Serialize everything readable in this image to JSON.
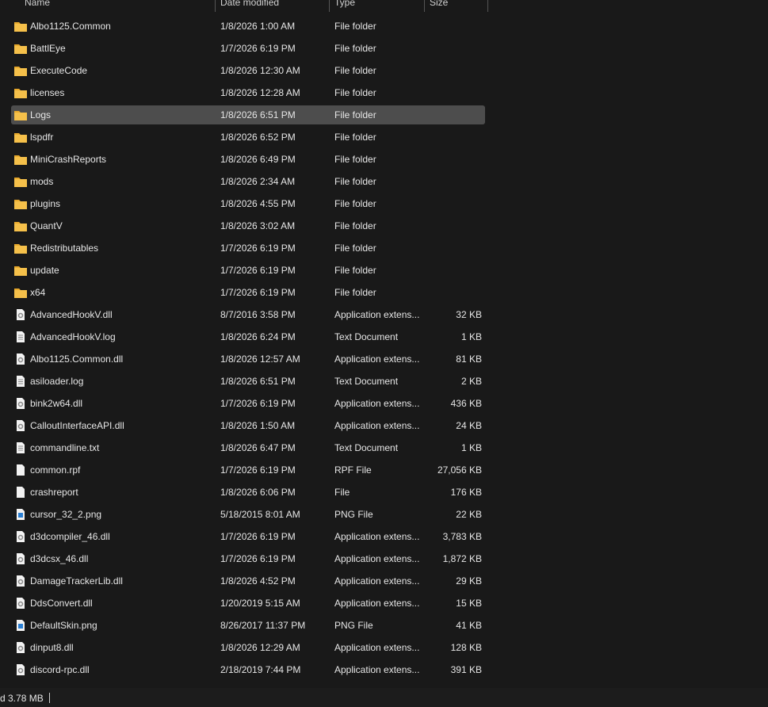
{
  "columns": {
    "name": "Name",
    "date": "Date modified",
    "type": "Type",
    "size": "Size"
  },
  "selected_index": 4,
  "files": [
    {
      "name": "Albo1125.Common",
      "date": "1/8/2026 1:00 AM",
      "type": "File folder",
      "size": "",
      "icon": "folder"
    },
    {
      "name": "BattlEye",
      "date": "1/7/2026 6:19 PM",
      "type": "File folder",
      "size": "",
      "icon": "folder"
    },
    {
      "name": "ExecuteCode",
      "date": "1/8/2026 12:30 AM",
      "type": "File folder",
      "size": "",
      "icon": "folder"
    },
    {
      "name": "licenses",
      "date": "1/8/2026 12:28 AM",
      "type": "File folder",
      "size": "",
      "icon": "folder"
    },
    {
      "name": "Logs",
      "date": "1/8/2026 6:51 PM",
      "type": "File folder",
      "size": "",
      "icon": "folder"
    },
    {
      "name": "lspdfr",
      "date": "1/8/2026 6:52 PM",
      "type": "File folder",
      "size": "",
      "icon": "folder"
    },
    {
      "name": "MiniCrashReports",
      "date": "1/8/2026 6:49 PM",
      "type": "File folder",
      "size": "",
      "icon": "folder"
    },
    {
      "name": "mods",
      "date": "1/8/2026 2:34 AM",
      "type": "File folder",
      "size": "",
      "icon": "folder"
    },
    {
      "name": "plugins",
      "date": "1/8/2026 4:55 PM",
      "type": "File folder",
      "size": "",
      "icon": "folder"
    },
    {
      "name": "QuantV",
      "date": "1/8/2026 3:02 AM",
      "type": "File folder",
      "size": "",
      "icon": "folder"
    },
    {
      "name": "Redistributables",
      "date": "1/7/2026 6:19 PM",
      "type": "File folder",
      "size": "",
      "icon": "folder"
    },
    {
      "name": "update",
      "date": "1/7/2026 6:19 PM",
      "type": "File folder",
      "size": "",
      "icon": "folder"
    },
    {
      "name": "x64",
      "date": "1/7/2026 6:19 PM",
      "type": "File folder",
      "size": "",
      "icon": "folder"
    },
    {
      "name": "AdvancedHookV.dll",
      "date": "8/7/2016 3:58 PM",
      "type": "Application extens...",
      "size": "32 KB",
      "icon": "dll"
    },
    {
      "name": "AdvancedHookV.log",
      "date": "1/8/2026 6:24 PM",
      "type": "Text Document",
      "size": "1 KB",
      "icon": "text"
    },
    {
      "name": "Albo1125.Common.dll",
      "date": "1/8/2026 12:57 AM",
      "type": "Application extens...",
      "size": "81 KB",
      "icon": "dll"
    },
    {
      "name": "asiloader.log",
      "date": "1/8/2026 6:51 PM",
      "type": "Text Document",
      "size": "2 KB",
      "icon": "text"
    },
    {
      "name": "bink2w64.dll",
      "date": "1/7/2026 6:19 PM",
      "type": "Application extens...",
      "size": "436 KB",
      "icon": "dll"
    },
    {
      "name": "CalloutInterfaceAPI.dll",
      "date": "1/8/2026 1:50 AM",
      "type": "Application extens...",
      "size": "24 KB",
      "icon": "dll"
    },
    {
      "name": "commandline.txt",
      "date": "1/8/2026 6:47 PM",
      "type": "Text Document",
      "size": "1 KB",
      "icon": "text"
    },
    {
      "name": "common.rpf",
      "date": "1/7/2026 6:19 PM",
      "type": "RPF File",
      "size": "27,056 KB",
      "icon": "file"
    },
    {
      "name": "crashreport",
      "date": "1/8/2026 6:06 PM",
      "type": "File",
      "size": "176 KB",
      "icon": "file"
    },
    {
      "name": "cursor_32_2.png",
      "date": "5/18/2015 8:01 AM",
      "type": "PNG File",
      "size": "22 KB",
      "icon": "image"
    },
    {
      "name": "d3dcompiler_46.dll",
      "date": "1/7/2026 6:19 PM",
      "type": "Application extens...",
      "size": "3,783 KB",
      "icon": "dll"
    },
    {
      "name": "d3dcsx_46.dll",
      "date": "1/7/2026 6:19 PM",
      "type": "Application extens...",
      "size": "1,872 KB",
      "icon": "dll"
    },
    {
      "name": "DamageTrackerLib.dll",
      "date": "1/8/2026 4:52 PM",
      "type": "Application extens...",
      "size": "29 KB",
      "icon": "dll"
    },
    {
      "name": "DdsConvert.dll",
      "date": "1/20/2019 5:15 AM",
      "type": "Application extens...",
      "size": "15 KB",
      "icon": "dll"
    },
    {
      "name": "DefaultSkin.png",
      "date": "8/26/2017 11:37 PM",
      "type": "PNG File",
      "size": "41 KB",
      "icon": "image"
    },
    {
      "name": "dinput8.dll",
      "date": "1/8/2026 12:29 AM",
      "type": "Application extens...",
      "size": "128 KB",
      "icon": "dll"
    },
    {
      "name": "discord-rpc.dll",
      "date": "2/18/2019 7:44 PM",
      "type": "Application extens...",
      "size": "391 KB",
      "icon": "dll"
    }
  ],
  "status": {
    "selection_size": "d  3.78 MB"
  },
  "colors": {
    "background": "#191919",
    "selected": "#4d4d4d",
    "folder": "#f5c04a"
  }
}
